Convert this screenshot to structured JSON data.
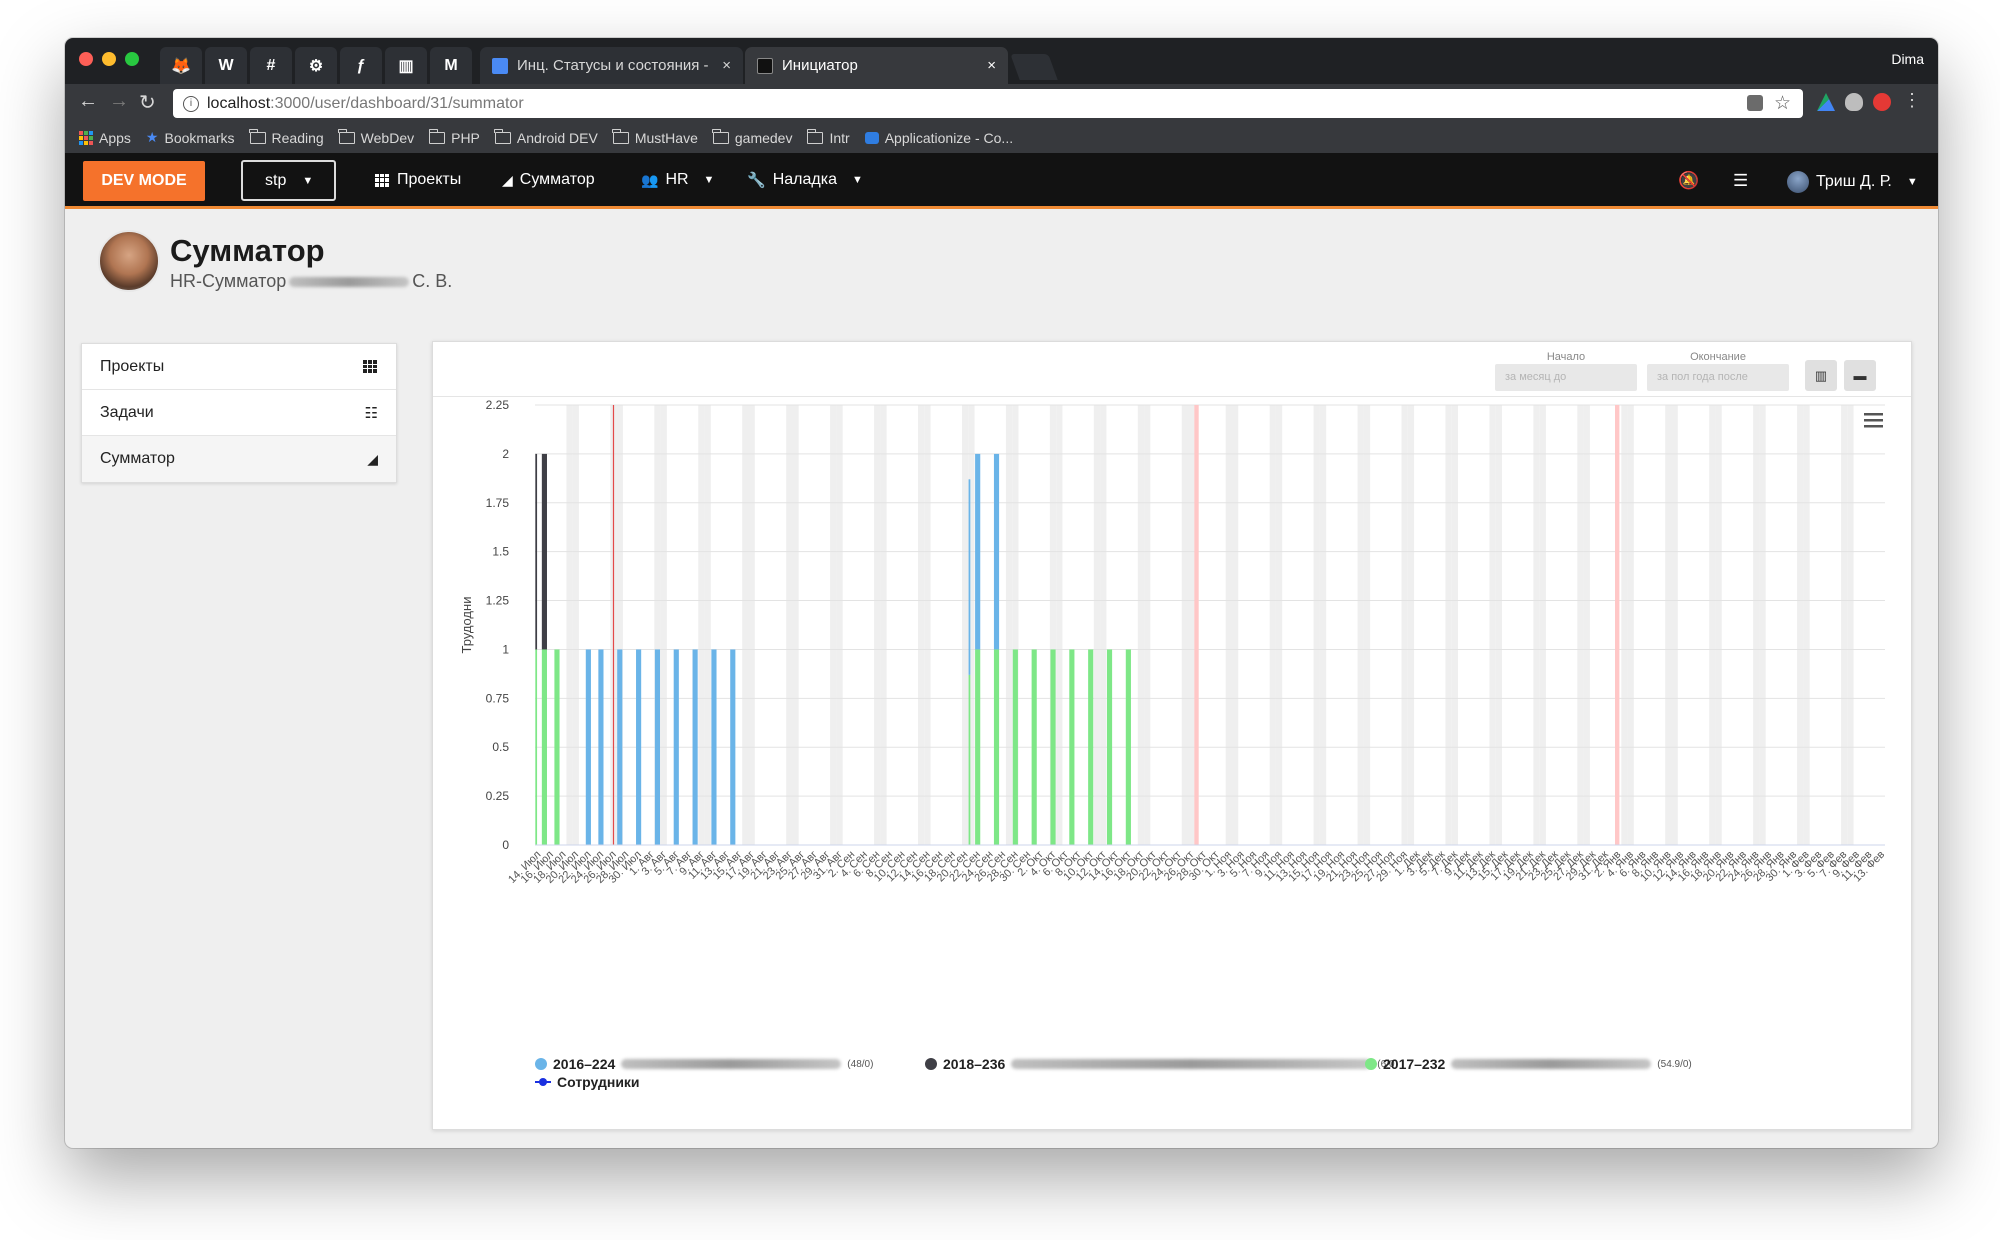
{
  "browser": {
    "user": "Dima",
    "pinned_tabs": [
      {
        "icon": "gitlab-icon",
        "glyph": "🦊",
        "bg": "#2d3035"
      },
      {
        "icon": "wordpress-icon",
        "glyph": "W",
        "bg": "#2d3035"
      },
      {
        "icon": "slack-icon",
        "glyph": "#",
        "bg": "#2d3035"
      },
      {
        "icon": "app-icon",
        "glyph": "⚙",
        "bg": "#2d3035"
      },
      {
        "icon": "symfony-icon",
        "glyph": "ƒ",
        "bg": "#2d3035"
      },
      {
        "icon": "trello-icon",
        "glyph": "▥",
        "bg": "#2d3035"
      },
      {
        "icon": "medium-icon",
        "glyph": "M",
        "bg": "#2d3035"
      }
    ],
    "tabs": [
      {
        "title": "Инц. Статусы и состояния - Google",
        "active": false
      },
      {
        "title": "Инициатор",
        "active": true
      }
    ],
    "url_host": "localhost",
    "url_rest": ":3000/user/dashboard/31/summator",
    "bookmarks": [
      "Apps",
      "Bookmarks",
      "Reading",
      "WebDev",
      "PHP",
      "Android DEV",
      "MustHave",
      "gamedev",
      "Intr",
      "Applicationize - Co..."
    ]
  },
  "nav": {
    "dev_mode": "DEV MODE",
    "project_select": "stp",
    "projects": "Проекты",
    "summator": "Сумматор",
    "hr": "HR",
    "setup": "Наладка",
    "user": "Триш Д. Р."
  },
  "page": {
    "title": "Сумматор",
    "subtitle_prefix": "HR-Сумматор",
    "subtitle_suffix": "С. В."
  },
  "side_menu": [
    {
      "label": "Проекты",
      "icon": "grid-icon"
    },
    {
      "label": "Задачи",
      "icon": "list-icon"
    },
    {
      "label": "Сумматор",
      "icon": "area-chart-icon"
    }
  ],
  "filters": {
    "start_label": "Начало",
    "start_placeholder": "за месяц до",
    "end_label": "Окончание",
    "end_placeholder": "за пол года после"
  },
  "legend": [
    {
      "name": "2016–224",
      "suffix": "(48/0)",
      "color": "#6ab4e8"
    },
    {
      "name": "2018–236",
      "suffix": "(6/0)",
      "color": "#3f3f46"
    },
    {
      "name": "2017–232",
      "suffix": "(54.9/0)",
      "color": "#7ee787"
    },
    {
      "name": "Сотрудники",
      "suffix": "",
      "color": "#1a30e0"
    }
  ],
  "colors": {
    "blue": "#6ab4e8",
    "dark": "#3f3f46",
    "green": "#7ee787",
    "accent": "#f5722b"
  },
  "chart_data": {
    "type": "bar",
    "stacked": true,
    "ylabel": "Трудодни",
    "ylim": [
      0,
      2.25
    ],
    "yticks": [
      "0",
      "0.25",
      "0.5",
      "0.75",
      "1",
      "1.25",
      "1.5",
      "1.75",
      "2",
      "2.25"
    ],
    "categories": [
      "14. Июл",
      "16. Июл",
      "18. Июл",
      "20. Июл",
      "22. Июл",
      "24. Июл",
      "26. Июл",
      "28. Июл",
      "30. Июл",
      "1. Авг",
      "3. Авг",
      "5. Авг",
      "7. Авг",
      "9. Авг",
      "11. Авг",
      "13. Авг",
      "15. Авг",
      "17. Авг",
      "19. Авг",
      "21. Авг",
      "23. Авг",
      "25. Авг",
      "27. Авг",
      "29. Авг",
      "31. Авг",
      "2. Сен",
      "4. Сен",
      "6. Сен",
      "8. Сен",
      "10. Сен",
      "12. Сен",
      "14. Сен",
      "16. Сен",
      "18. Сен",
      "20. Сен",
      "22. Сен",
      "24. Сен",
      "26. Сен",
      "28. Сен",
      "30. Сен",
      "2. Окт",
      "4. Окт",
      "6. Окт",
      "8. Окт",
      "10. Окт",
      "12. Окт",
      "14. Окт",
      "16. Окт",
      "18. Окт",
      "20. Окт",
      "22. Окт",
      "24. Окт",
      "26. Окт",
      "28. Окт",
      "30. Окт",
      "1. Ноя",
      "3. Ноя",
      "5. Ноя",
      "7. Ноя",
      "9. Ноя",
      "11. Ноя",
      "13. Ноя",
      "15. Ноя",
      "17. Ноя",
      "19. Ноя",
      "21. Ноя",
      "23. Ноя",
      "25. Ноя",
      "27. Ноя",
      "29. Ноя",
      "1. Дек",
      "3. Дек",
      "5. Дек",
      "7. Дек",
      "9. Дек",
      "11. Дек",
      "13. Дек",
      "15. Дек",
      "17. Дек",
      "19. Дек",
      "21. Дек",
      "23. Дек",
      "25. Дек",
      "27. Дек",
      "29. Дек",
      "31. Дек",
      "2. Янв",
      "4. Янв",
      "6. Янв",
      "8. Янв",
      "10. Янв",
      "12. Янв",
      "14. Янв",
      "16. Янв",
      "18. Янв",
      "20. Янв",
      "22. Янв",
      "24. Янв",
      "26. Янв",
      "28. Янв",
      "30. Янв",
      "1. Фев",
      "3. Фев",
      "5. Фев",
      "7. Фев",
      "9. Фев",
      "11. Фев",
      "13. Фев"
    ],
    "series": [
      {
        "name": "2017–232",
        "color": "#7ee787",
        "stack_order": 0,
        "points": [
          {
            "date": "14. Июл",
            "value": 1
          },
          {
            "date": "15. Июл",
            "value": 1
          },
          {
            "date": "17. Июл",
            "value": 1
          },
          {
            "date": "21. Сен",
            "value": 0.87
          },
          {
            "date": "22. Сен",
            "value": 1
          },
          {
            "date": "25. Сен",
            "value": 1
          },
          {
            "date": "28. Сен",
            "value": 1
          },
          {
            "date": "1. Окт",
            "value": 1
          },
          {
            "date": "4. Окт",
            "value": 1
          },
          {
            "date": "7. Окт",
            "value": 1
          },
          {
            "date": "10. Окт",
            "value": 1
          },
          {
            "date": "13. Окт",
            "value": 1
          },
          {
            "date": "16. Окт",
            "value": 1
          }
        ]
      },
      {
        "name": "2018–236",
        "color": "#3f3f46",
        "stack_order": 1,
        "points": [
          {
            "date": "14. Июл",
            "value": 1
          },
          {
            "date": "15. Июл",
            "value": 1
          }
        ]
      },
      {
        "name": "2016–224",
        "color": "#6ab4e8",
        "stack_order": 2,
        "points": [
          {
            "date": "22. Июл",
            "value": 1
          },
          {
            "date": "24. Июл",
            "value": 1
          },
          {
            "date": "27. Июл",
            "value": 1
          },
          {
            "date": "30. Июл",
            "value": 1
          },
          {
            "date": "2. Авг",
            "value": 1
          },
          {
            "date": "5. Авг",
            "value": 1
          },
          {
            "date": "8. Авг",
            "value": 1
          },
          {
            "date": "11. Авг",
            "value": 1
          },
          {
            "date": "14. Авг",
            "value": 1
          },
          {
            "date": "21. Сен",
            "value": 1
          },
          {
            "date": "22. Сен",
            "value": 1
          },
          {
            "date": "25. Сен",
            "value": 1
          }
        ]
      }
    ],
    "plot_lines": [
      {
        "date": "26. Июл",
        "color": "#e34a4a"
      },
      {
        "date": "27. Окт",
        "color": "#ffc7c7"
      },
      {
        "date": "2. Янв",
        "color": "#ffc7c7"
      }
    ],
    "legend_position": "bottom",
    "grid": true
  }
}
